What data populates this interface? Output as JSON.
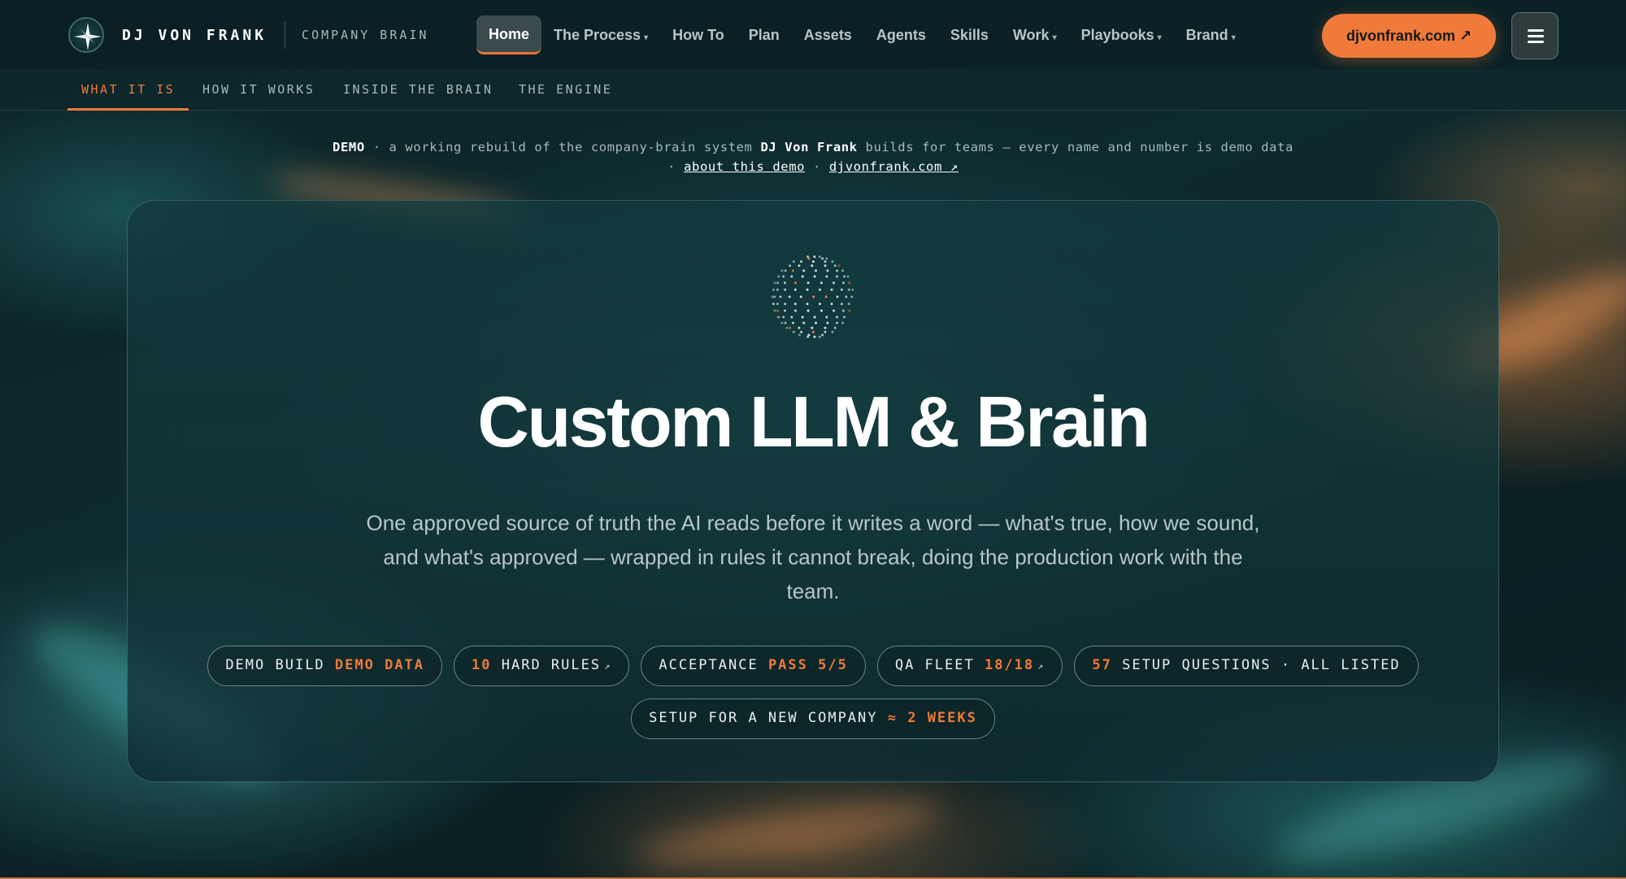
{
  "brand": {
    "name": "DJ VON FRANK",
    "subtitle": "COMPANY BRAIN"
  },
  "nav": {
    "items": [
      {
        "label": "Home",
        "active": true,
        "has_caret": false
      },
      {
        "label": "The Process",
        "has_caret": true
      },
      {
        "label": "How To",
        "has_caret": false
      },
      {
        "label": "Plan",
        "has_caret": false
      },
      {
        "label": "Assets",
        "has_caret": false
      },
      {
        "label": "Agents",
        "has_caret": false
      },
      {
        "label": "Skills",
        "has_caret": false
      },
      {
        "label": "Work",
        "has_caret": true
      },
      {
        "label": "Playbooks",
        "has_caret": true
      },
      {
        "label": "Brand",
        "has_caret": true
      }
    ],
    "cta_label": "djvonfrank.com ↗",
    "menu_icon": "hamburger-icon"
  },
  "subnav": {
    "items": [
      {
        "label": "WHAT IT IS",
        "active": true
      },
      {
        "label": "HOW IT WORKS"
      },
      {
        "label": "INSIDE THE BRAIN"
      },
      {
        "label": "THE ENGINE"
      }
    ]
  },
  "notice": {
    "tag": "DEMO",
    "text_before": " · a working rebuild of the company-brain system ",
    "name": "DJ Von Frank",
    "text_after": " builds for teams — every name and number is demo data",
    "link_about": "about this demo",
    "link_site": "djvonfrank.com ↗",
    "sep": "·"
  },
  "hero": {
    "title": "Custom LLM & Brain",
    "lede": "One approved source of truth the AI reads before it writes a word — what's true, how we sound, and what's approved — wrapped in rules it cannot break, doing the production work with the team."
  },
  "pills": [
    {
      "pre": "DEMO BUILD ",
      "hl": "DEMO DATA",
      "post": "",
      "arrow": false
    },
    {
      "pre": "",
      "hl": "10",
      "post": " HARD RULES",
      "arrow": true
    },
    {
      "pre": "ACCEPTANCE ",
      "hl": "PASS 5/5",
      "post": "",
      "arrow": false
    },
    {
      "pre": "QA FLEET ",
      "hl": "18/18",
      "post": "",
      "arrow": true
    },
    {
      "pre": "",
      "hl": "57",
      "post": " SETUP QUESTIONS · ALL LISTED",
      "arrow": false
    },
    {
      "pre": "SETUP FOR A NEW COMPANY ",
      "hl": "≈ 2 WEEKS",
      "post": "",
      "arrow": false
    }
  ],
  "colors": {
    "accent": "#ef7a3a",
    "background": "#0d2a2e",
    "card": "#13393d"
  }
}
